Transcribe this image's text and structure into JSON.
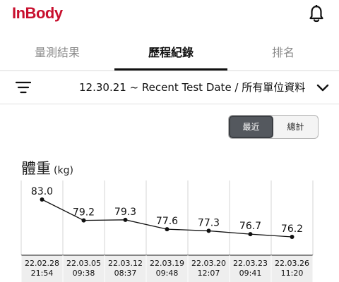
{
  "app": {
    "logo": "InBody"
  },
  "header": {
    "bell_icon": "bell-icon"
  },
  "tabs": [
    {
      "label": "量測結果",
      "active": false
    },
    {
      "label": "歷程紀錄",
      "active": true
    },
    {
      "label": "排名",
      "active": false
    }
  ],
  "filter": {
    "icon": "filter-icon",
    "text": "12.30.21 ~ Recent Test Date / 所有單位資料",
    "chevron_icon": "chevron-down-icon"
  },
  "segment": {
    "left_label": "最近",
    "right_label": "總計",
    "selected": "最近"
  },
  "metric": {
    "title": "體重",
    "unit": "(kg)"
  },
  "chart_data": {
    "type": "line",
    "title": "體重",
    "ylabel": "(kg)",
    "x": [
      "22.02.28 21:54",
      "22.03.05 09:38",
      "22.03.12 08:37",
      "22.03.19 09:48",
      "22.03.20 12:07",
      "22.03.23 09:41",
      "22.03.26 11:20"
    ],
    "date_labels": [
      "22.02.28",
      "22.03.05",
      "22.03.12",
      "22.03.19",
      "22.03.20",
      "22.03.23",
      "22.03.26"
    ],
    "time_labels": [
      "21:54",
      "09:38",
      "08:37",
      "09:48",
      "12:07",
      "09:41",
      "11:20"
    ],
    "values": [
      83.0,
      79.2,
      79.3,
      77.6,
      77.3,
      76.7,
      76.2
    ],
    "value_labels": [
      "83.0",
      "79.2",
      "79.3",
      "77.6",
      "77.3",
      "76.7",
      "76.2"
    ],
    "grid": true
  }
}
